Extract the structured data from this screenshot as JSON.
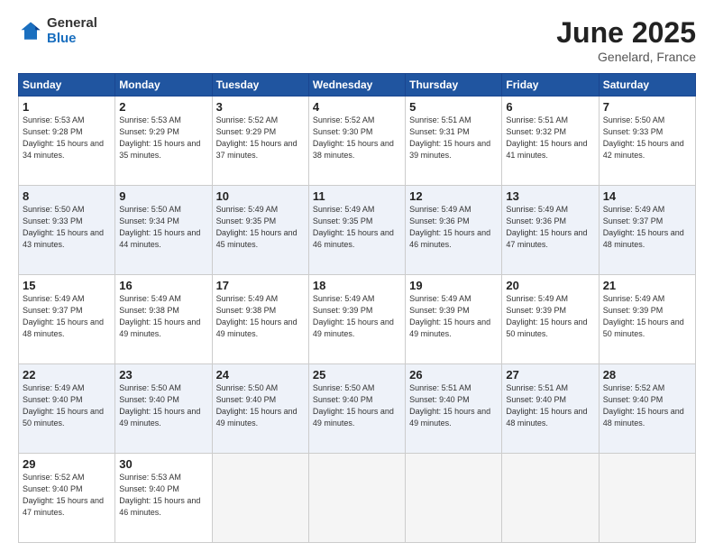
{
  "logo": {
    "general": "General",
    "blue": "Blue"
  },
  "title": {
    "month": "June 2025",
    "location": "Genelard, France"
  },
  "headers": [
    "Sunday",
    "Monday",
    "Tuesday",
    "Wednesday",
    "Thursday",
    "Friday",
    "Saturday"
  ],
  "weeks": [
    [
      {
        "day": "1",
        "sunrise": "5:53 AM",
        "sunset": "9:28 PM",
        "daylight": "15 hours and 34 minutes."
      },
      {
        "day": "2",
        "sunrise": "5:53 AM",
        "sunset": "9:29 PM",
        "daylight": "15 hours and 35 minutes."
      },
      {
        "day": "3",
        "sunrise": "5:52 AM",
        "sunset": "9:29 PM",
        "daylight": "15 hours and 37 minutes."
      },
      {
        "day": "4",
        "sunrise": "5:52 AM",
        "sunset": "9:30 PM",
        "daylight": "15 hours and 38 minutes."
      },
      {
        "day": "5",
        "sunrise": "5:51 AM",
        "sunset": "9:31 PM",
        "daylight": "15 hours and 39 minutes."
      },
      {
        "day": "6",
        "sunrise": "5:51 AM",
        "sunset": "9:32 PM",
        "daylight": "15 hours and 41 minutes."
      },
      {
        "day": "7",
        "sunrise": "5:50 AM",
        "sunset": "9:33 PM",
        "daylight": "15 hours and 42 minutes."
      }
    ],
    [
      {
        "day": "8",
        "sunrise": "5:50 AM",
        "sunset": "9:33 PM",
        "daylight": "15 hours and 43 minutes."
      },
      {
        "day": "9",
        "sunrise": "5:50 AM",
        "sunset": "9:34 PM",
        "daylight": "15 hours and 44 minutes."
      },
      {
        "day": "10",
        "sunrise": "5:49 AM",
        "sunset": "9:35 PM",
        "daylight": "15 hours and 45 minutes."
      },
      {
        "day": "11",
        "sunrise": "5:49 AM",
        "sunset": "9:35 PM",
        "daylight": "15 hours and 46 minutes."
      },
      {
        "day": "12",
        "sunrise": "5:49 AM",
        "sunset": "9:36 PM",
        "daylight": "15 hours and 46 minutes."
      },
      {
        "day": "13",
        "sunrise": "5:49 AM",
        "sunset": "9:36 PM",
        "daylight": "15 hours and 47 minutes."
      },
      {
        "day": "14",
        "sunrise": "5:49 AM",
        "sunset": "9:37 PM",
        "daylight": "15 hours and 48 minutes."
      }
    ],
    [
      {
        "day": "15",
        "sunrise": "5:49 AM",
        "sunset": "9:37 PM",
        "daylight": "15 hours and 48 minutes."
      },
      {
        "day": "16",
        "sunrise": "5:49 AM",
        "sunset": "9:38 PM",
        "daylight": "15 hours and 49 minutes."
      },
      {
        "day": "17",
        "sunrise": "5:49 AM",
        "sunset": "9:38 PM",
        "daylight": "15 hours and 49 minutes."
      },
      {
        "day": "18",
        "sunrise": "5:49 AM",
        "sunset": "9:39 PM",
        "daylight": "15 hours and 49 minutes."
      },
      {
        "day": "19",
        "sunrise": "5:49 AM",
        "sunset": "9:39 PM",
        "daylight": "15 hours and 49 minutes."
      },
      {
        "day": "20",
        "sunrise": "5:49 AM",
        "sunset": "9:39 PM",
        "daylight": "15 hours and 50 minutes."
      },
      {
        "day": "21",
        "sunrise": "5:49 AM",
        "sunset": "9:39 PM",
        "daylight": "15 hours and 50 minutes."
      }
    ],
    [
      {
        "day": "22",
        "sunrise": "5:49 AM",
        "sunset": "9:40 PM",
        "daylight": "15 hours and 50 minutes."
      },
      {
        "day": "23",
        "sunrise": "5:50 AM",
        "sunset": "9:40 PM",
        "daylight": "15 hours and 49 minutes."
      },
      {
        "day": "24",
        "sunrise": "5:50 AM",
        "sunset": "9:40 PM",
        "daylight": "15 hours and 49 minutes."
      },
      {
        "day": "25",
        "sunrise": "5:50 AM",
        "sunset": "9:40 PM",
        "daylight": "15 hours and 49 minutes."
      },
      {
        "day": "26",
        "sunrise": "5:51 AM",
        "sunset": "9:40 PM",
        "daylight": "15 hours and 49 minutes."
      },
      {
        "day": "27",
        "sunrise": "5:51 AM",
        "sunset": "9:40 PM",
        "daylight": "15 hours and 48 minutes."
      },
      {
        "day": "28",
        "sunrise": "5:52 AM",
        "sunset": "9:40 PM",
        "daylight": "15 hours and 48 minutes."
      }
    ],
    [
      {
        "day": "29",
        "sunrise": "5:52 AM",
        "sunset": "9:40 PM",
        "daylight": "15 hours and 47 minutes."
      },
      {
        "day": "30",
        "sunrise": "5:53 AM",
        "sunset": "9:40 PM",
        "daylight": "15 hours and 46 minutes."
      },
      null,
      null,
      null,
      null,
      null
    ]
  ]
}
